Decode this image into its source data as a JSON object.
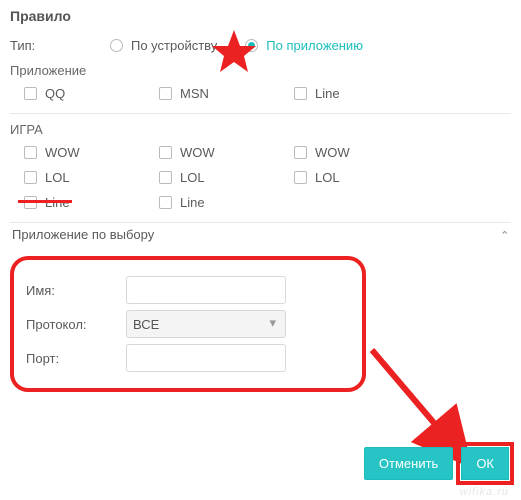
{
  "title": "Правило",
  "type": {
    "label": "Тип:",
    "options": [
      {
        "label": "По устройству",
        "value": "device",
        "checked": false
      },
      {
        "label": "По приложению",
        "value": "app",
        "checked": true
      }
    ]
  },
  "app_section": {
    "label": "Приложение",
    "items": [
      "QQ",
      "MSN",
      "Line"
    ]
  },
  "game_section": {
    "label": "ИГРА",
    "items": [
      "WOW",
      "WOW",
      "WOW",
      "LOL",
      "LOL",
      "LOL",
      "Line",
      "Line"
    ]
  },
  "custom_app": {
    "label": "Приложение по выбору"
  },
  "form": {
    "name_label": "Имя:",
    "name_value": "",
    "protocol_label": "Протокол:",
    "protocol_value": "ВСЕ",
    "port_label": "Порт:",
    "port_value": ""
  },
  "buttons": {
    "cancel": "Отменить",
    "ok": "ОК"
  },
  "watermark": "wifika.ru"
}
